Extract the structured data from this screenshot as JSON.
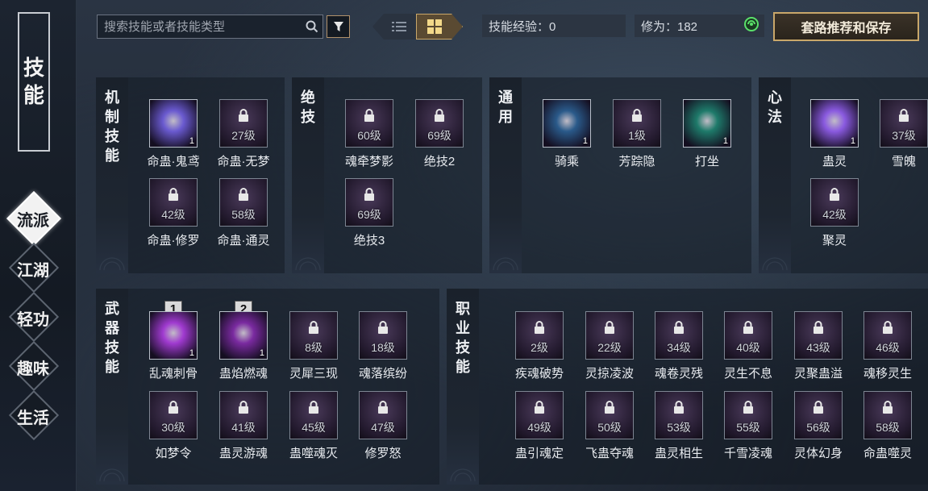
{
  "nav": {
    "title": [
      "技",
      "能"
    ],
    "items": [
      {
        "label": "流派",
        "active": true
      },
      {
        "label": "江湖",
        "active": false
      },
      {
        "label": "轻功",
        "active": false
      },
      {
        "label": "趣味",
        "active": false
      },
      {
        "label": "生活",
        "active": false
      }
    ]
  },
  "toolbar": {
    "search_placeholder": "搜索技能或者技能类型",
    "skill_exp": "技能经验：0",
    "cultivation_label": "修为：182",
    "recommend_label": "套路推荐和保存"
  },
  "sections": {
    "mechanism": {
      "label": [
        "机",
        "制",
        "技",
        "能"
      ]
    },
    "ultimate": {
      "label": [
        "绝",
        "技"
      ]
    },
    "general": {
      "label": [
        "通",
        "用"
      ]
    },
    "mind": {
      "label": [
        "心",
        "法"
      ]
    },
    "weapon": {
      "label": [
        "武",
        "器",
        "技",
        "能"
      ]
    },
    "career": {
      "label": [
        "职",
        "业",
        "技",
        "能"
      ]
    }
  },
  "skills": {
    "mechanism": [
      {
        "name": "命蛊·鬼鸢",
        "count": "1",
        "unlocked": true,
        "color": "#6a5ad0"
      },
      {
        "name": "命蛊·无梦",
        "level": "27级"
      },
      {
        "name": "命蛊·修罗",
        "level": "42级"
      },
      {
        "name": "命蛊·通灵",
        "level": "58级"
      }
    ],
    "ultimate": [
      {
        "name": "魂牵梦影",
        "level": "60级"
      },
      {
        "name": "绝技2",
        "level": "69级"
      },
      {
        "name": "绝技3",
        "level": "69级"
      }
    ],
    "general": [
      {
        "name": "骑乘",
        "count": "1",
        "unlocked": true,
        "color": "#2a5a8a"
      },
      {
        "name": "芳踪隐",
        "level": "1级"
      },
      {
        "name": "打坐",
        "count": "1",
        "unlocked": true,
        "color": "#1e7a6a"
      }
    ],
    "mind": [
      {
        "name": "蛊灵",
        "count": "1",
        "unlocked": true,
        "color": "#8a5ae0"
      },
      {
        "name": "雪魄",
        "level": "37级"
      },
      {
        "name": "聚灵",
        "level": "42级"
      }
    ],
    "weapon": [
      {
        "name": "乱魂刺骨",
        "count": "1",
        "slot": "1",
        "unlocked": true,
        "color": "#a03ad0"
      },
      {
        "name": "蛊焰燃魂",
        "count": "1",
        "slot": "2",
        "unlocked": true,
        "color": "#7a2aa0"
      },
      {
        "name": "灵犀三现",
        "level": "8级"
      },
      {
        "name": "魂落缤纷",
        "level": "18级"
      },
      {
        "name": "如梦令",
        "level": "30级"
      },
      {
        "name": "蛊灵游魂",
        "level": "41级"
      },
      {
        "name": "蛊噬魂灭",
        "level": "45级"
      },
      {
        "name": "修罗怒",
        "level": "47级"
      }
    ],
    "career": [
      {
        "name": "疾魂破势",
        "level": "2级"
      },
      {
        "name": "灵掠凌波",
        "level": "22级"
      },
      {
        "name": "魂卷灵残",
        "level": "34级"
      },
      {
        "name": "灵生不息",
        "level": "40级"
      },
      {
        "name": "灵聚蛊溢",
        "level": "43级"
      },
      {
        "name": "魂移灵生",
        "level": "46级"
      },
      {
        "name": "蛊引魂定",
        "level": "49级"
      },
      {
        "name": "飞蛊夺魂",
        "level": "50级"
      },
      {
        "name": "蛊灵相生",
        "level": "53级"
      },
      {
        "name": "千雪凌魂",
        "level": "55级"
      },
      {
        "name": "灵体幻身",
        "level": "56级"
      },
      {
        "name": "命蛊噬灵",
        "level": "58级"
      }
    ]
  }
}
